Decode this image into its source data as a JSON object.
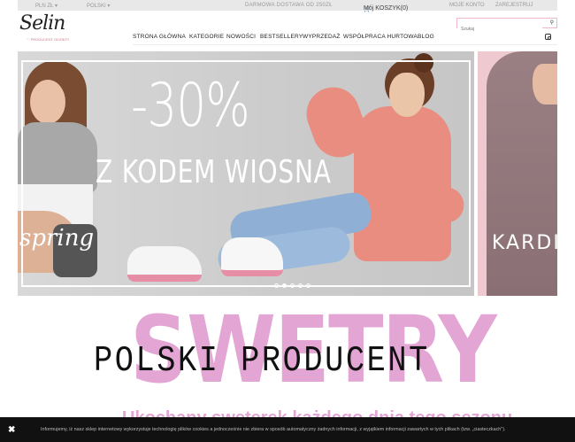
{
  "topbar": {
    "currency": "PLN ZŁ ▾",
    "language": "POLSKI ▾",
    "shipping": "DARMOWA DOSTAWA OD 250ZŁ",
    "cart": "Mój KOSZYK(0)",
    "account": "MOJE KONTO",
    "register": "ZAREJESTRUJ"
  },
  "logo": {
    "text": "Selin",
    "tagline": "♡ PRODUCENT ODZIEŻY"
  },
  "search": {
    "placeholder": "Szukaj"
  },
  "nav": {
    "items": [
      "STRONA GŁÓWNA",
      "KATEGORIE",
      "NOWOŚCI",
      "BESTSELLERY",
      "WYPRZEDAŻ",
      "WSPÓŁPRACA HURTOWA",
      "BLOG"
    ]
  },
  "hero": {
    "discount": "-30%",
    "code_line": "Z KODEM WIOSNA",
    "left_text": "spring",
    "right_text": "KARDI",
    "slides_count": 5,
    "active_slide": 1
  },
  "section": {
    "background_word": "SWETRY",
    "headline": "POLSKI PRODUCENT",
    "teaser": "Ukochany sweterek każdego dnia tego sezonu"
  },
  "cookie": {
    "close": "✖",
    "text": "Informujemy, iż nasz sklep internetowy wykorzystuje technologię plików cookies a jednocześnie nie zbiera w sposób automatyczny żadnych informacji, z wyjątkiem informacji zawartych w tych plikach (tzw. „ciasteczkach\")."
  },
  "colors": {
    "accent_pink": "#e3a6d4",
    "topbar_bg": "#e8e8e8",
    "cookie_bg": "#111111"
  }
}
